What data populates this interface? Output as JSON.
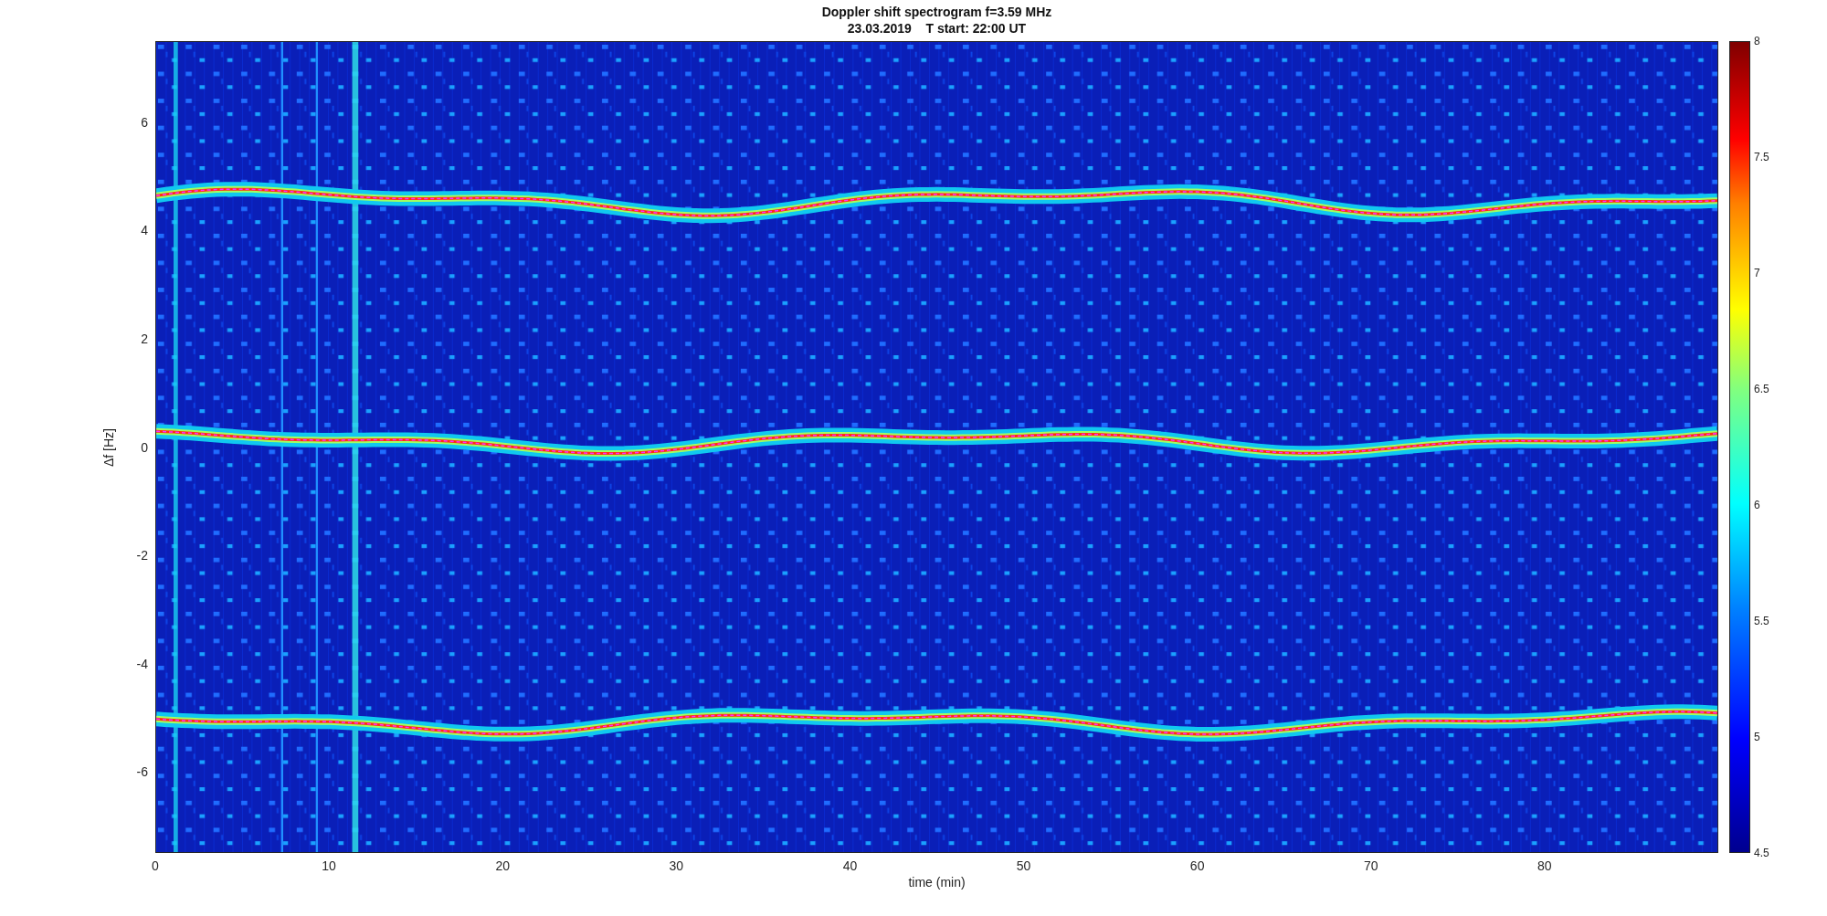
{
  "title": {
    "main": "Doppler shift spectrogram f=3.59 MHz",
    "subtitle": "23.03.2019    T start: 22:00 UT"
  },
  "axes": {
    "xlabel": "time (min)",
    "ylabel": "Δf [Hz]",
    "xticks": [
      "0",
      "10",
      "20",
      "30",
      "40",
      "50",
      "60",
      "70",
      "80"
    ],
    "yticks": [
      "6",
      "4",
      "2",
      "0",
      "-2",
      "-4",
      "-6"
    ]
  },
  "colorbar": {
    "ticks": [
      "8",
      "7.5",
      "7",
      "6.5",
      "6",
      "5.5",
      "5",
      "4.5"
    ]
  }
}
